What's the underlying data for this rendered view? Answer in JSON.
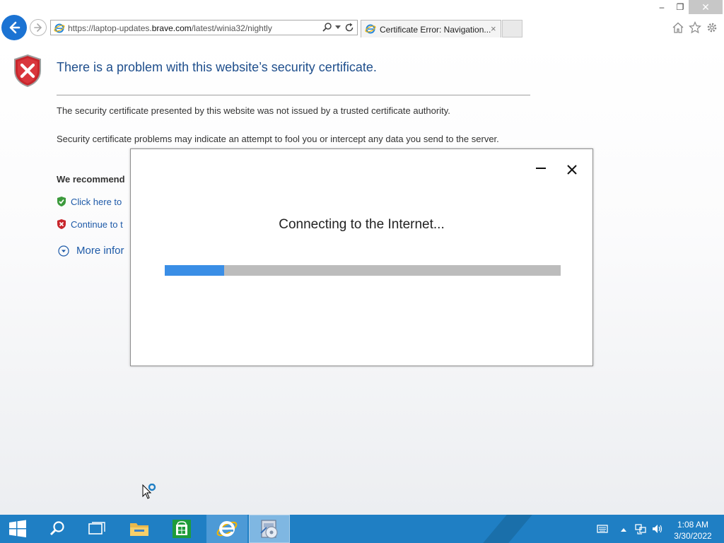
{
  "browser": {
    "address_prefix": "https://laptop-updates.",
    "address_domain": "brave.com",
    "address_suffix": "/latest/winia32/nightly",
    "tab_title": "Certificate Error: Navigation...",
    "tab_close": "×"
  },
  "window_controls": {
    "minimize": "–",
    "restore": "❐",
    "close": "✕"
  },
  "page": {
    "title": "There is a problem with this website’s security certificate.",
    "para1": "The security certificate presented by this website was not issued by a trusted certificate authority.",
    "para2": "Security certificate problems may indicate an attempt to fool you or intercept any data you send to the server.",
    "recommend": "We recommend",
    "option1": "Click here to",
    "option2": "Continue to t",
    "more_info": "More infor"
  },
  "dialog": {
    "message": "Connecting to the Internet...",
    "progress_fraction": 0.15,
    "progress_color": "#3a8ee6"
  },
  "taskbar": {
    "time": "1:08 AM",
    "date": "3/30/2022",
    "icons": [
      "start-icon",
      "search-icon",
      "task-view-icon",
      "file-explorer-icon",
      "store-icon",
      "internet-explorer-icon",
      "setup-icon"
    ]
  },
  "colors": {
    "accent": "#1b73d3",
    "title_blue": "#1e4e8c",
    "link_blue": "#1e5aa8",
    "taskbar": "#1f7fc4"
  }
}
